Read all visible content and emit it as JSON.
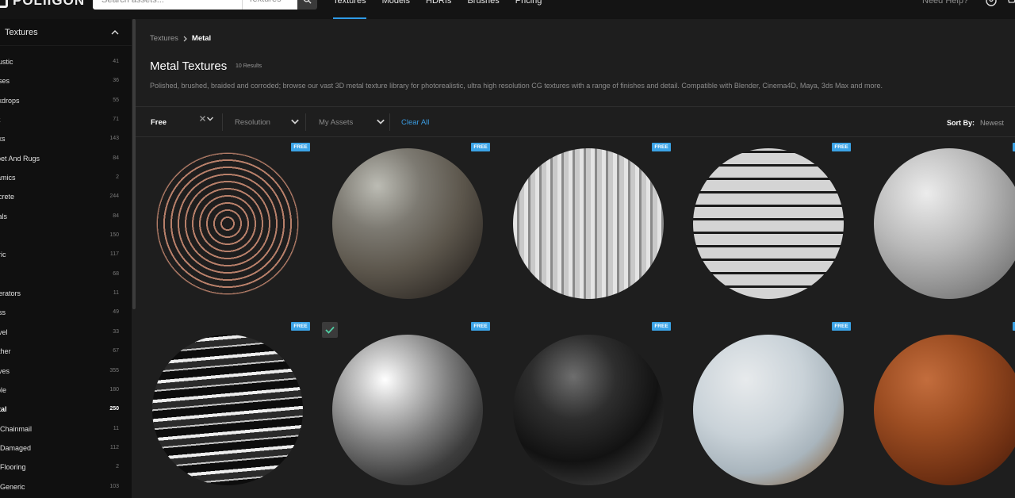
{
  "header": {
    "logo_text": "POLIIGON",
    "search_placeholder": "Search assets...",
    "search_type": "Textures",
    "nav": [
      "Textures",
      "Models",
      "HDRIs",
      "Brushes",
      "Pricing"
    ],
    "active_nav": "Textures",
    "help": "Need Help?"
  },
  "sidebar": {
    "heading": "Textures",
    "categories": [
      {
        "label": "oustic",
        "count": "41"
      },
      {
        "label": "ases",
        "count": "36"
      },
      {
        "label": "ckdrops",
        "count": "55"
      },
      {
        "label": "rk",
        "count": "71"
      },
      {
        "label": "cks",
        "count": "143"
      },
      {
        "label": "rpet And Rugs",
        "count": "84"
      },
      {
        "label": "ramics",
        "count": "2"
      },
      {
        "label": "ncrete",
        "count": "244"
      },
      {
        "label": "cals",
        "count": "84"
      },
      {
        "label": "t",
        "count": "150"
      },
      {
        "label": "bric",
        "count": "117"
      },
      {
        "label": "e",
        "count": "68"
      },
      {
        "label": "nerators",
        "count": "11"
      },
      {
        "label": "ass",
        "count": "49"
      },
      {
        "label": "avel",
        "count": "33"
      },
      {
        "label": "ather",
        "count": "67"
      },
      {
        "label": "aves",
        "count": "355"
      },
      {
        "label": "rble",
        "count": "180"
      },
      {
        "label": "etal",
        "count": "250",
        "active": true
      },
      {
        "label": "Chainmail",
        "count": "11",
        "sub": true
      },
      {
        "label": "Damaged",
        "count": "112",
        "sub": true
      },
      {
        "label": "Flooring",
        "count": "2",
        "sub": true
      },
      {
        "label": "Generic",
        "count": "103",
        "sub": true
      }
    ]
  },
  "main": {
    "breadcrumb_root": "Textures",
    "breadcrumb_current": "Metal",
    "title": "Metal Textures",
    "result_count": "10 Results",
    "description": "Polished, brushed, braided and corroded; browse our vast 3D metal texture library for photorealistic, ultra high resolution CG textures with a range of finishes and detail. Compatible with Blender, Cinema4D, Maya, 3ds Max and more.",
    "filters": {
      "free": "Free",
      "resolution": "Resolution",
      "my_assets": "My Assets",
      "clear_all": "Clear All",
      "sort_by_label": "Sort By:",
      "sort_value": "Newest"
    },
    "badge_text": "FREE",
    "grid": [
      {
        "material": "copper-chainmail",
        "badge": true
      },
      {
        "material": "rusty-rough-metal",
        "badge": true
      },
      {
        "material": "corrugated-silver-metal",
        "badge": true
      },
      {
        "material": "woven-steel-metal",
        "badge": true
      },
      {
        "material": "brushed-panel-metal",
        "badge": true
      },
      {
        "material": "painted-scratched-metal",
        "badge": true
      },
      {
        "material": "polished-worn-metal",
        "badge": true,
        "selected": true
      },
      {
        "material": "dark-chrome-metal",
        "badge": true
      },
      {
        "material": "scratched-painted-rust-metal",
        "badge": true
      },
      {
        "material": "rusted-orange-metal",
        "badge": true
      }
    ]
  },
  "colors": {
    "accent": "#3ba3e6",
    "link": "#3a9be0",
    "background": "#1e1e1e",
    "sidebar_background": "#101010"
  }
}
